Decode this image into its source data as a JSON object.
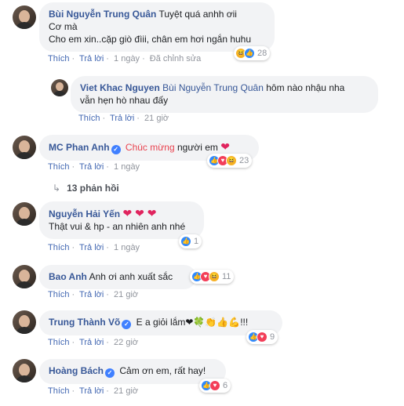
{
  "actions": {
    "like": "Thích",
    "reply": "Trả lời",
    "sep": "·"
  },
  "comments": [
    {
      "author": "Bùi Nguyễn Trung Quân",
      "lines": [
        "Tuyệt quá anhh ơii",
        "Cơ mà",
        "Cho em xin..cặp giò đìii, chân em hơi ngắn huhu"
      ],
      "time": "1 ngày",
      "edited": "Đã chỉnh sửa",
      "reaction_count": "28",
      "reaction_icons": [
        "haha-icon",
        "like-icon"
      ]
    },
    {
      "author": "Viet Khac Nguyen",
      "mention": "Bùi Nguyễn Trung Quân",
      "text1": "hôm nào nhậu nha",
      "text2": "vẫn hẹn hò nhau đấy",
      "time": "21 giờ"
    },
    {
      "author": "MC Phan Anh",
      "highlight": "Chúc mừng",
      "text": "người em",
      "emoji": "❤",
      "time": "1 ngày",
      "reaction_count": "23",
      "reaction_icons": [
        "like-icon",
        "love-icon",
        "haha-icon"
      ],
      "replies": "13 phản hồi",
      "replies_arrow": "↳"
    },
    {
      "author": "Nguyễn Hải Yến",
      "emoji": "❤ ❤ ❤",
      "text": "Thật vui & hp - an nhiên anh nhé",
      "time": "1 ngày",
      "reaction_count": "1",
      "reaction_icons": [
        "like-icon"
      ]
    },
    {
      "author": "Bao Anh",
      "text": "Anh ơi anh xuất sắc",
      "time": "21 giờ",
      "reaction_count": "11",
      "reaction_icons": [
        "like-icon",
        "love-icon",
        "haha-icon"
      ]
    },
    {
      "author": "Trung Thành Võ",
      "text": "E a giỏi lắm❤🍀👏👍💪!!!",
      "time": "22 giờ",
      "reaction_count": "9",
      "reaction_icons": [
        "like-icon",
        "love-icon"
      ]
    },
    {
      "author": "Hoàng Bách",
      "text": "Cảm ơn em, rất hay!",
      "time": "21 giờ",
      "reaction_count": "6",
      "reaction_icons": [
        "like-icon",
        "love-icon"
      ]
    }
  ],
  "icons": {
    "like": "👍",
    "love": "♥",
    "haha": "😆"
  },
  "colors": {
    "link": "#385898",
    "bubble": "#f2f3f5",
    "like": "#2e89ff",
    "love": "#f33e58",
    "haha": "#f7b125"
  }
}
